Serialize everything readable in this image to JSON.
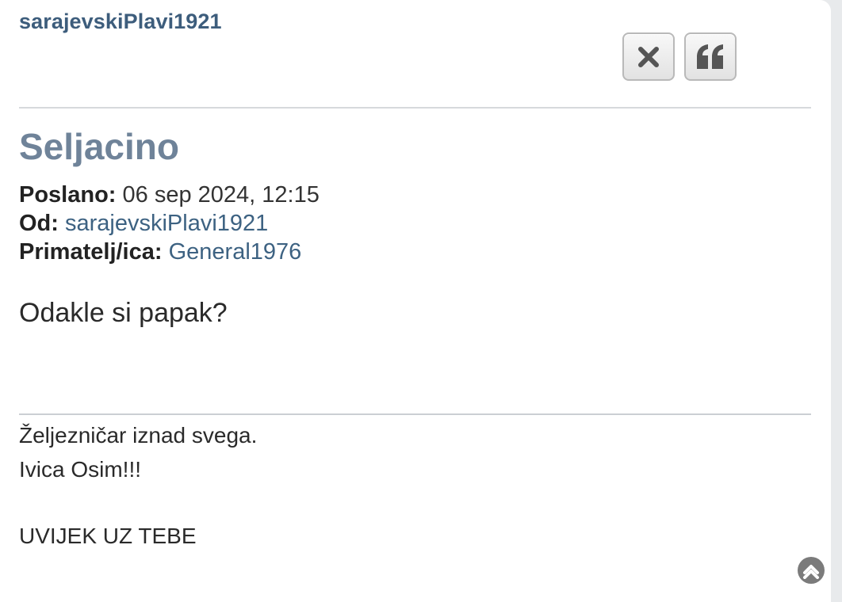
{
  "message": {
    "author": "sarajevskiPlavi1921",
    "subject": "Seljacino",
    "sent_label": "Poslano:",
    "sent_value": "06 sep 2024, 12:15",
    "from_label": "Od:",
    "from_value": "sarajevskiPlavi1921",
    "to_label": "Primatelj/ica:",
    "to_value": "General1976",
    "body": "Odakle si papak?"
  },
  "signature": {
    "line1": "Željezničar iznad svega.",
    "line2": "Ivica Osim!!!",
    "line3": "UVIJEK UZ TEBE"
  },
  "actions": {
    "delete_icon": "close-icon",
    "quote_icon": "quote-icon",
    "top_icon": "chevron-up-icon"
  },
  "colors": {
    "author": "#3d5d7c",
    "subject": "#6f8399",
    "link": "#3d6282"
  }
}
